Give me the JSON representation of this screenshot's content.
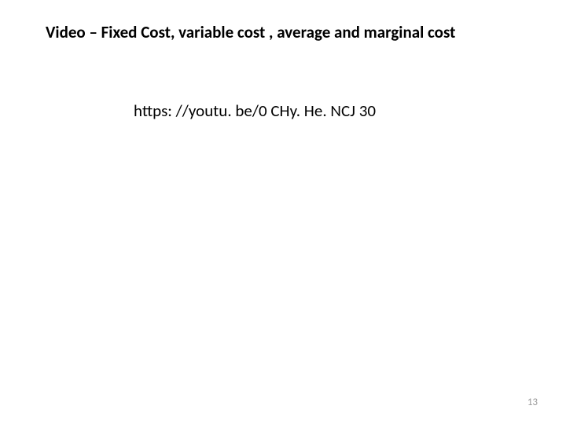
{
  "slide": {
    "title": "Video – Fixed Cost, variable cost , average and marginal cost",
    "link": "https: //youtu. be/0 CHy. He. NCJ 30",
    "page_number": "13"
  }
}
